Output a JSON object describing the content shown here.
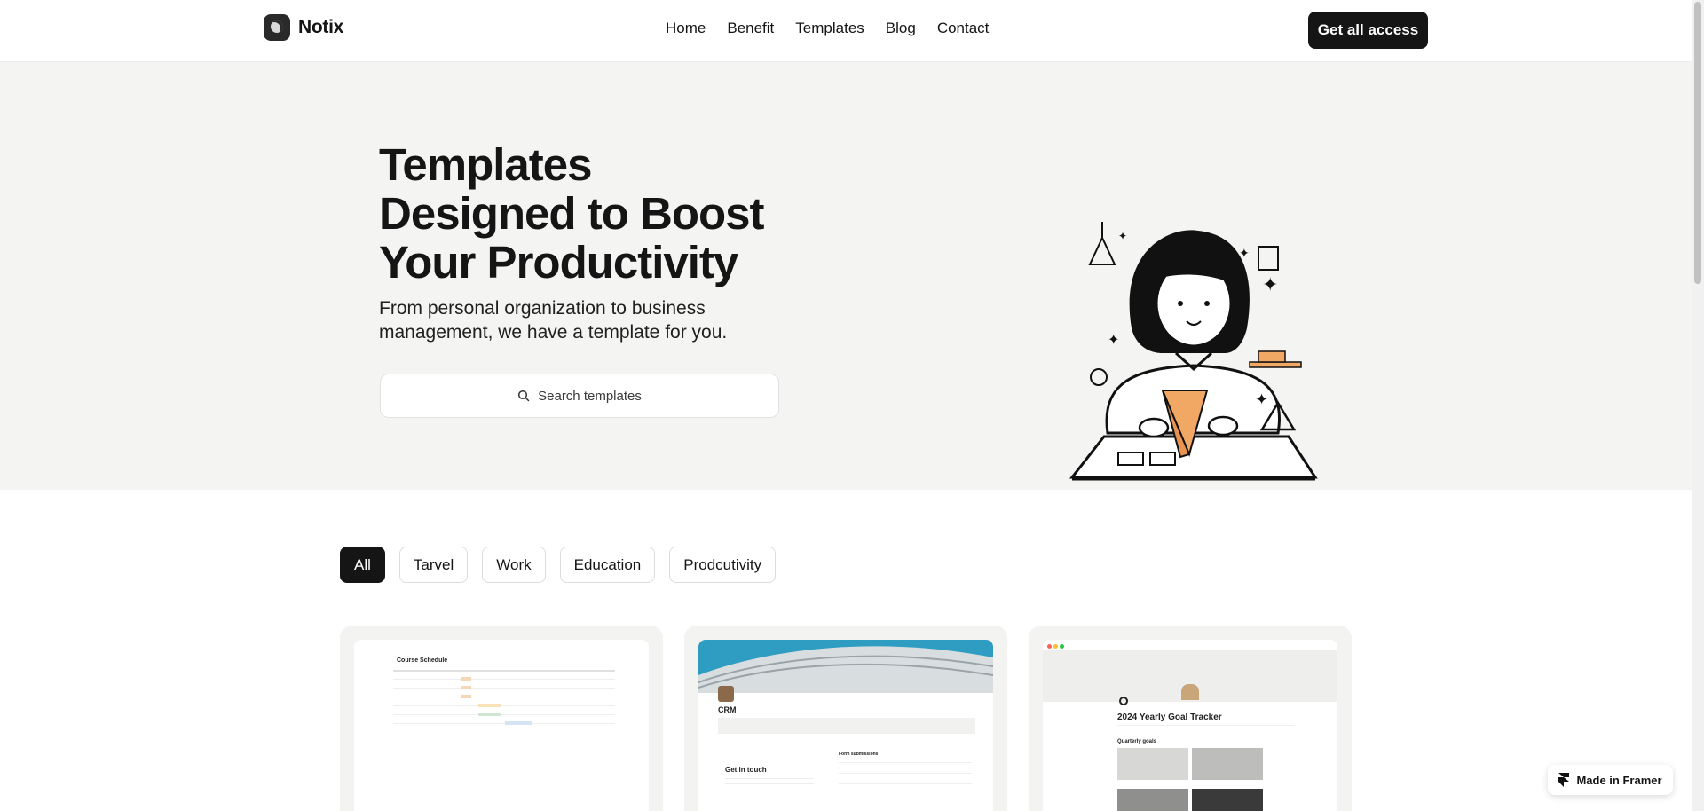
{
  "header": {
    "logo_text": "Notix",
    "nav": [
      "Home",
      "Benefit",
      "Templates",
      "Blog",
      "Contact"
    ],
    "cta_label": "Get all access"
  },
  "hero": {
    "title_lines": [
      "Templates",
      "Designed to Boost",
      "Your Productivity"
    ],
    "subtitle": "From personal organization to business management, we have a template for you.",
    "search_placeholder": "Search templates",
    "illustration_icon": "woman-reading-illustration",
    "accent_color": "#f2a865"
  },
  "filters": {
    "items": [
      "All",
      "Tarvel",
      "Work",
      "Education",
      "Prodcutivity"
    ],
    "active": "All"
  },
  "cards": [
    {
      "title": "Course Schedule"
    },
    {
      "title": "CRM",
      "section": "Get in touch",
      "side_heading": "Form submissions"
    },
    {
      "title": "2024 Yearly Goal Tracker",
      "section": "Quarterly goals"
    }
  ],
  "badge": {
    "label": "Made in Framer",
    "icon": "framer-icon"
  }
}
